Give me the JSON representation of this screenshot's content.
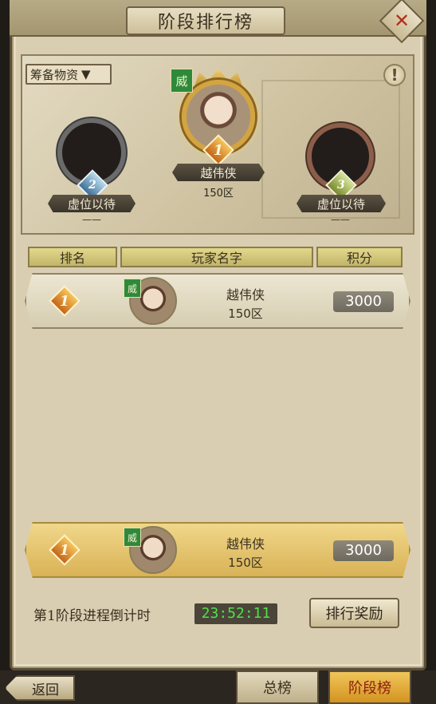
{
  "header": {
    "title": "阶段排行榜",
    "close_glyph": "✕"
  },
  "filter": {
    "label": "筹备物资",
    "arrow": "▼"
  },
  "info_glyph": "!",
  "podium": {
    "first": {
      "rank": "1",
      "badge": "威",
      "name": "越伟侠",
      "server": "150区"
    },
    "second": {
      "rank": "2",
      "name": "虚位以待",
      "server": "——"
    },
    "third": {
      "rank": "3",
      "name": "虚位以待",
      "server": "——"
    }
  },
  "table": {
    "headers": [
      "排名",
      "玩家名字",
      "积分"
    ],
    "rows": [
      {
        "rank": "1",
        "badge": "威",
        "name": "越伟侠",
        "server": "150区",
        "score": "3000"
      }
    ],
    "self_row": {
      "rank": "1",
      "badge": "威",
      "name": "越伟侠",
      "server": "150区",
      "score": "3000"
    }
  },
  "countdown": {
    "label": "第1阶段进程倒计时",
    "time": "23:52:11"
  },
  "buttons": {
    "reward": "排行奖励",
    "back": "返回"
  },
  "tabs": {
    "total": "总榜",
    "stage": "阶段榜"
  },
  "colors": {
    "timer_text": "#4fe14a",
    "active_tab": "#d39320",
    "close_x": "#b32e1c"
  }
}
